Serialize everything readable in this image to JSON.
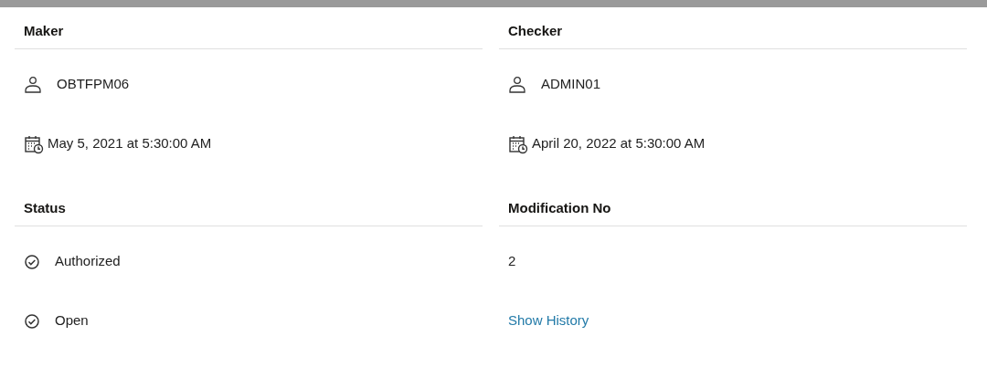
{
  "sections": [
    {
      "title": "Maker",
      "items": [
        {
          "kind": "user",
          "text": "OBTFPM06"
        },
        {
          "kind": "date",
          "text": "May 5, 2021 at 5:30:00 AM"
        }
      ]
    },
    {
      "title": "Checker",
      "items": [
        {
          "kind": "user",
          "text": "ADMIN01"
        },
        {
          "kind": "date",
          "text": "April 20, 2022 at 5:30:00 AM"
        }
      ]
    },
    {
      "title": "Status",
      "items": [
        {
          "kind": "status",
          "text": "Authorized"
        },
        {
          "kind": "status",
          "text": "Open"
        }
      ]
    },
    {
      "title": "Modification No",
      "items": [
        {
          "kind": "plain",
          "text": "2"
        },
        {
          "kind": "link",
          "text": "Show History"
        }
      ]
    }
  ]
}
